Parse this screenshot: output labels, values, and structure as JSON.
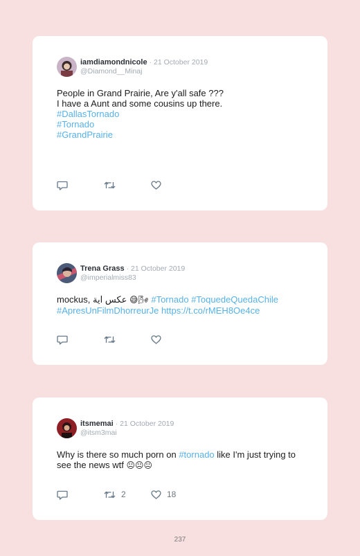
{
  "tweets": [
    {
      "name": "iamdiamondnicole",
      "date": "· 21 October 2019",
      "handle": "@Diamond__Minaj",
      "text_1": "People in Grand Prairie, Are y'all safe ???",
      "text_2": "I have a Aunt and some cousins up there.",
      "hashtag_1": "#DallasTornado",
      "hashtag_2": "#Tornado",
      "hashtag_3": "#GrandPrairie",
      "retweets": "",
      "likes": ""
    },
    {
      "name": "Trena Grass",
      "date": "· 21 October 2019",
      "handle": "@imperialmiss83",
      "text_1": "mockus, عكس اية",
      "emoji_1": "😅🌬",
      "hashtag_1": "#Tornado",
      "hashtag_2": "#ToquedeQuedaChile",
      "hashtag_3": "#ApresUnFilmDhorreurJe",
      "link_1": "https://t.co/rMEH8Oe4ce",
      "retweets": "",
      "likes": ""
    },
    {
      "name": "itsmemai",
      "date": "· 21 October 2019",
      "handle": "@itsm3mai",
      "text_1": "Why is there so much porn on",
      "hashtag_1": "#tornado",
      "text_2": "like I'm just trying to",
      "text_3": "see the news wtf",
      "emoji_1": "😐😐😐",
      "retweets": "2",
      "likes": "18"
    }
  ],
  "page_number": "237",
  "colors": {
    "background": "#f8dfe0",
    "card": "#ffffff",
    "link": "#57b1e8",
    "muted": "#a3aab2",
    "icon": "#657786"
  },
  "icons": [
    "reply-icon",
    "retweet-icon",
    "like-icon"
  ]
}
